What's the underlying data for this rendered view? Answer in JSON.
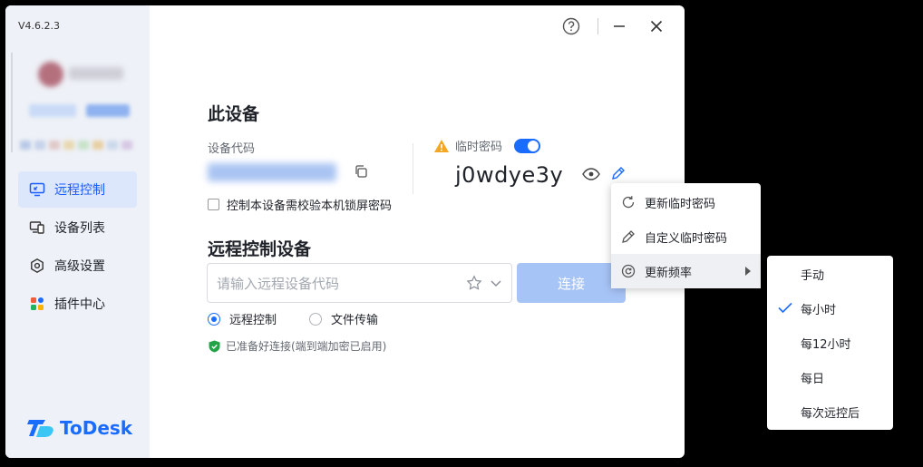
{
  "app": {
    "version": "V4.6.2.3",
    "logo_text": "ToDesk",
    "brand_color": "#1a6cff"
  },
  "sidebar": {
    "items": [
      {
        "label": "远程控制",
        "icon": "remote-control-icon",
        "active": true
      },
      {
        "label": "设备列表",
        "icon": "device-list-icon",
        "active": false
      },
      {
        "label": "高级设置",
        "icon": "advanced-settings-icon",
        "active": false
      },
      {
        "label": "插件中心",
        "icon": "plugin-center-icon",
        "active": false
      }
    ]
  },
  "this_device": {
    "title": "此设备",
    "code_label": "设备代码",
    "temp_password_label": "临时密码",
    "temp_password": "j0wdye3y",
    "temp_password_enabled": true,
    "lock_screen_checkbox_label": "控制本设备需校验本机锁屏密码",
    "lock_screen_checked": false
  },
  "remote_control": {
    "title": "远程控制设备",
    "input_placeholder": "请输入远程设备代码",
    "connect_label": "连接",
    "modes": [
      {
        "label": "远程控制",
        "selected": true
      },
      {
        "label": "文件传输",
        "selected": false
      }
    ],
    "status_text": "已准备好连接(端到端加密已启用)"
  },
  "password_menu": {
    "items": [
      {
        "label": "更新临时密码",
        "icon": "refresh-icon"
      },
      {
        "label": "自定义临时密码",
        "icon": "pencil-icon"
      },
      {
        "label": "更新频率",
        "icon": "frequency-icon",
        "has_submenu": true
      }
    ]
  },
  "frequency_submenu": {
    "options": [
      {
        "label": "手动",
        "checked": false
      },
      {
        "label": "每小时",
        "checked": true
      },
      {
        "label": "每12小时",
        "checked": false
      },
      {
        "label": "每日",
        "checked": false
      },
      {
        "label": "每次远控后",
        "checked": false
      }
    ]
  }
}
